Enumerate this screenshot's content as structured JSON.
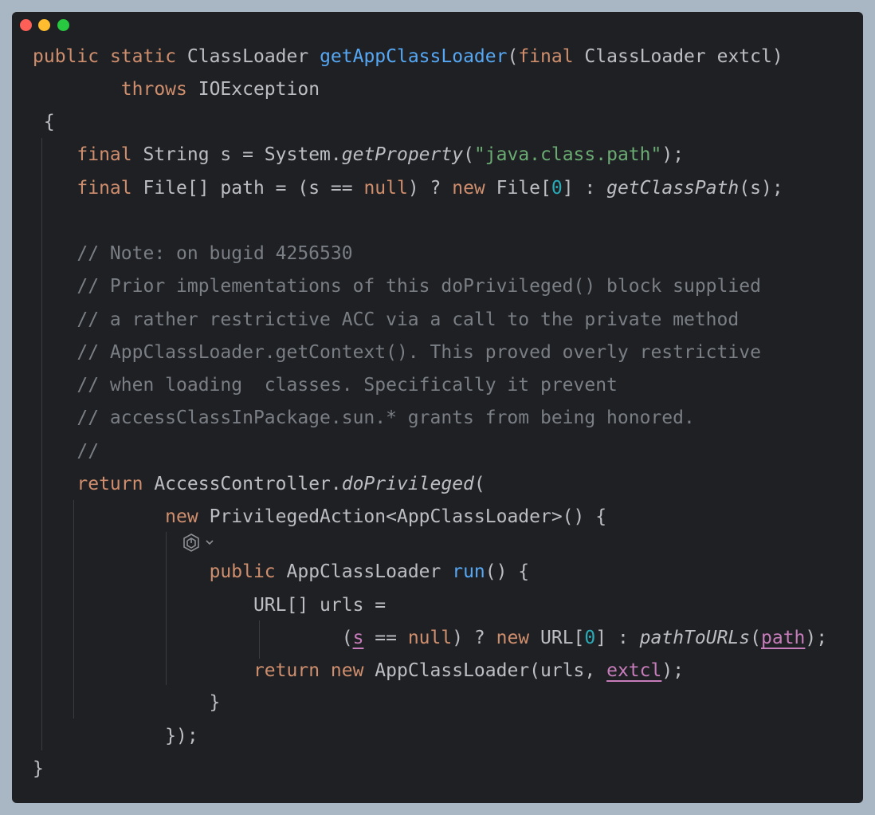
{
  "colors": {
    "background": "#a9b7c4",
    "editor_bg": "#1f2023",
    "text": "#bcbec4",
    "keyword": "#cf8e6d",
    "function": "#56a8f5",
    "string": "#6aab73",
    "number": "#2aacb8",
    "comment": "#7a7e85",
    "captured_var": "#c77dbb"
  },
  "window_controls": {
    "close": "#fe5f57",
    "minimize": "#febc2e",
    "maximize": "#28c840"
  },
  "code": {
    "l1": {
      "t1": "public",
      "t2": " ",
      "t3": "static",
      "t4": " ClassLoader ",
      "t5": "getAppClassLoader",
      "t6": "(",
      "t7": "final",
      "t8": " ClassLoader extcl)"
    },
    "l2": {
      "t1": "        ",
      "t2": "throws",
      "t3": " IOException"
    },
    "l3": {
      "t1": " {"
    },
    "l4": {
      "t1": "    ",
      "t2": "final",
      "t3": " String s = System.",
      "t4": "getProperty",
      "t5": "(",
      "t6": "\"java.class.path\"",
      "t7": ");"
    },
    "l5": {
      "t1": "    ",
      "t2": "final",
      "t3": " File[] path = (s == ",
      "t4": "null",
      "t5": ") ? ",
      "t6": "new",
      "t7": " File[",
      "t8": "0",
      "t9": "] : ",
      "t10": "getClassPath",
      "t11": "(s);"
    },
    "l7": {
      "t1": "    ",
      "t2": "// Note: on bugid 4256530"
    },
    "l8": {
      "t1": "    ",
      "t2": "// Prior implementations of this doPrivileged() block supplied"
    },
    "l9": {
      "t1": "    ",
      "t2": "// a rather restrictive ACC via a call to the private method"
    },
    "l10": {
      "t1": "    ",
      "t2": "// AppClassLoader.getContext(). This proved overly restrictive"
    },
    "l11": {
      "t1": "    ",
      "t2": "// when loading  classes. Specifically it prevent"
    },
    "l12": {
      "t1": "    ",
      "t2": "// accessClassInPackage.sun.* grants from being honored."
    },
    "l13": {
      "t1": "    ",
      "t2": "//"
    },
    "l14": {
      "t1": "    ",
      "t2": "return",
      "t3": " AccessController.",
      "t4": "doPrivileged",
      "t5": "("
    },
    "l15": {
      "t1": "            ",
      "t2": "new",
      "t3": " PrivilegedAction<AppClassLoader>() {"
    },
    "l16": {
      "t1": "                ",
      "t2": "public",
      "t3": " AppClassLoader ",
      "t4": "run",
      "t5": "() {"
    },
    "l17": {
      "t1": "                    URL[] urls ="
    },
    "l18": {
      "t1": "                            (",
      "t2": "s",
      "t3": " == ",
      "t4": "null",
      "t5": ") ? ",
      "t6": "new",
      "t7": " URL[",
      "t8": "0",
      "t9": "] : ",
      "t10": "pathToURLs",
      "t11": "(",
      "t12": "path",
      "t13": ");"
    },
    "l19": {
      "t1": "                    ",
      "t2": "return",
      "t3": " ",
      "t4": "new",
      "t5": " AppClassLoader(urls, ",
      "t6": "extcl",
      "t7": ");"
    },
    "l20": {
      "t1": "                }"
    },
    "l21": {
      "t1": "            });"
    },
    "l22": {
      "t1": "}"
    }
  }
}
